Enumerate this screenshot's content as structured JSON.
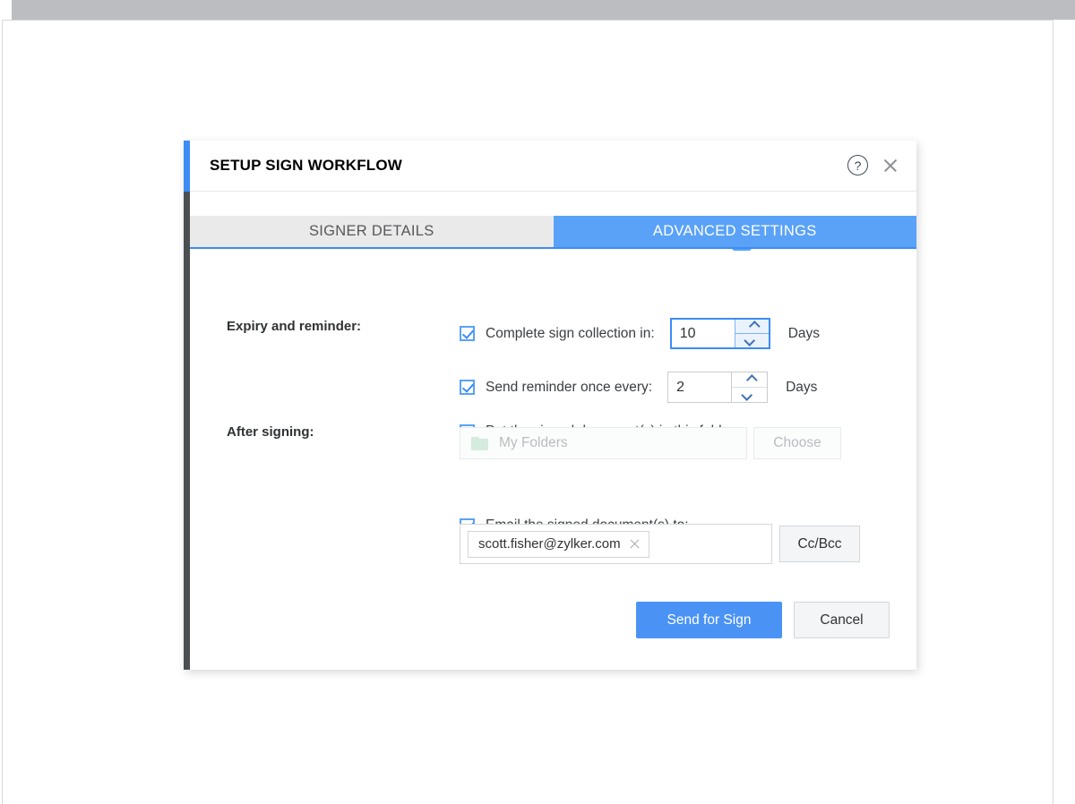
{
  "dialog": {
    "title": "SETUP SIGN WORKFLOW",
    "help_icon_glyph": "?",
    "accent_color": "#3b8cf5",
    "sidebar_color": "#4b4f52"
  },
  "tabs": [
    {
      "label": "SIGNER DETAILS",
      "active": false
    },
    {
      "label": "ADVANCED SETTINGS",
      "active": true
    }
  ],
  "sections": {
    "expiry": {
      "label": "Expiry and reminder:",
      "complete_sign": {
        "checkbox_checked": true,
        "label": "Complete sign collection in:",
        "value": "10",
        "unit": "Days",
        "focused": true
      },
      "send_reminder": {
        "checkbox_checked": true,
        "label": "Send reminder once every:",
        "value": "2",
        "unit": "Days",
        "focused": false
      }
    },
    "after_signing": {
      "label": "After signing:",
      "folder": {
        "checkbox_checked": false,
        "label": "Put the signed document(s) in this folder:",
        "placeholder": "My Folders",
        "value": "",
        "choose_label": "Choose",
        "folder_icon_color": "#d4ebdd"
      },
      "email": {
        "checkbox_checked": true,
        "label": "Email the signed document(s) to:",
        "recipients": [
          "scott.fisher@zylker.com"
        ],
        "ccbcc_label": "Cc/Bcc"
      }
    }
  },
  "actions": {
    "primary_label": "Send for Sign",
    "secondary_label": "Cancel",
    "primary_color": "#4a93f5"
  }
}
